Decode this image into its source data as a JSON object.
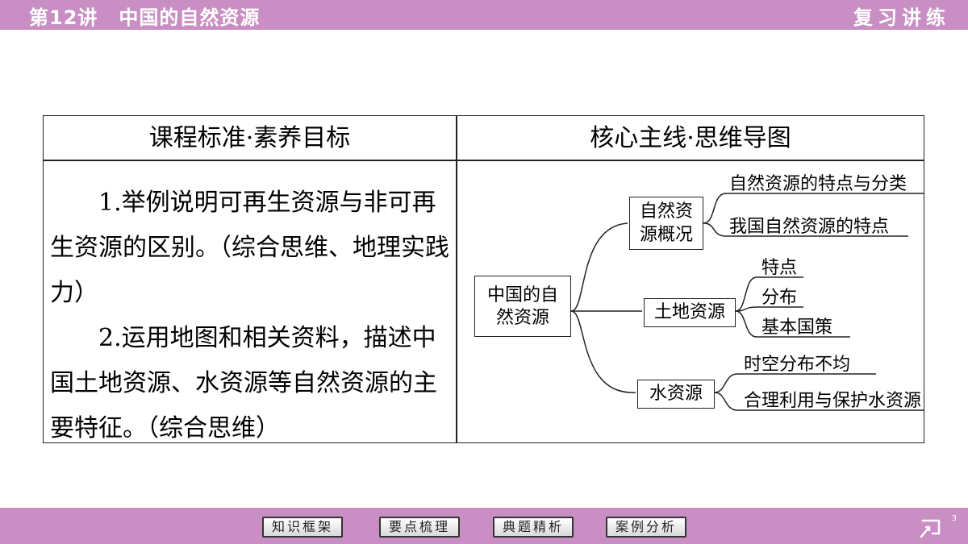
{
  "header": {
    "lecture_number": "第12讲",
    "lecture_title": "中国的自然资源",
    "section": "复习讲练"
  },
  "table": {
    "left_header": "课程标准·素养目标",
    "right_header": "核心主线·思维导图",
    "standards": [
      "1.举例说明可再生资源与非可再生资源的区别。（综合思维、地理实践力）",
      "2.运用地图和相关资料，描述中国土地资源、水资源等自然资源的主要特征。（综合思维）"
    ]
  },
  "mindmap": {
    "root": "中国的自然资源",
    "branches": [
      {
        "label": "自然资源概况",
        "children": [
          "自然资源的特点与分类",
          "我国自然资源的特点"
        ]
      },
      {
        "label": "土地资源",
        "children": [
          "特点",
          "分布",
          "基本国策"
        ]
      },
      {
        "label": "水资源",
        "children": [
          "时空分布不均",
          "合理利用与保护水资源"
        ]
      }
    ]
  },
  "footer": {
    "nav": [
      "知识框架",
      "要点梳理",
      "典题精析",
      "案例分析"
    ],
    "page_number": "3"
  },
  "colors": {
    "bar_background": "#c98ec3",
    "bar_text": "#ffffff",
    "line": "#222222"
  }
}
